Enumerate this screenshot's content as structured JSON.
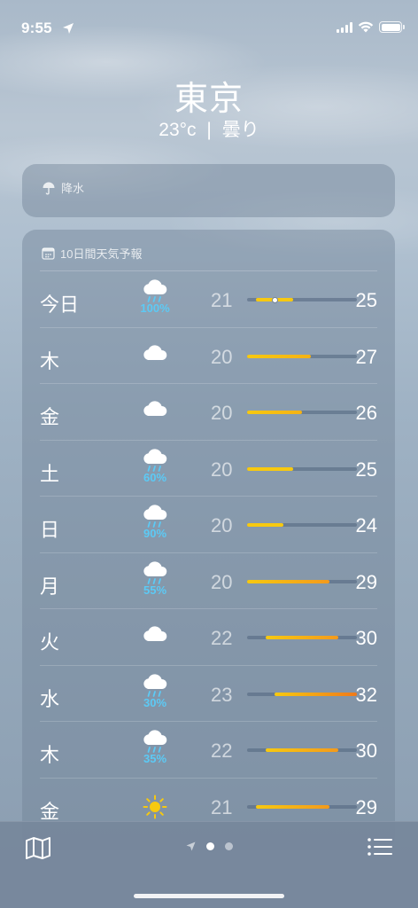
{
  "status_bar": {
    "time": "9:55"
  },
  "location": {
    "city": "東京",
    "temperature": "23°c",
    "separator": "|",
    "condition": "曇り"
  },
  "precipitation_card": {
    "title": "降水",
    "icon": "umbrella-icon"
  },
  "forecast": {
    "title": "10日間天気予報",
    "icon": "calendar-icon",
    "range_min": 20,
    "range_max": 32,
    "days": [
      {
        "day": "今日",
        "icon": "cloud-rain",
        "prob": "100%",
        "low": "21",
        "high": "25",
        "low_val": 21,
        "high_val": 25,
        "current": 23
      },
      {
        "day": "木",
        "icon": "cloud",
        "prob": "",
        "low": "20",
        "high": "27",
        "low_val": 20,
        "high_val": 27
      },
      {
        "day": "金",
        "icon": "cloud",
        "prob": "",
        "low": "20",
        "high": "26",
        "low_val": 20,
        "high_val": 26
      },
      {
        "day": "土",
        "icon": "cloud-rain",
        "prob": "60%",
        "low": "20",
        "high": "25",
        "low_val": 20,
        "high_val": 25
      },
      {
        "day": "日",
        "icon": "cloud-rain",
        "prob": "90%",
        "low": "20",
        "high": "24",
        "low_val": 20,
        "high_val": 24
      },
      {
        "day": "月",
        "icon": "cloud-rain",
        "prob": "55%",
        "low": "20",
        "high": "29",
        "low_val": 20,
        "high_val": 29
      },
      {
        "day": "火",
        "icon": "cloud",
        "prob": "",
        "low": "22",
        "high": "30",
        "low_val": 22,
        "high_val": 30
      },
      {
        "day": "水",
        "icon": "cloud-rain",
        "prob": "30%",
        "low": "23",
        "high": "32",
        "low_val": 23,
        "high_val": 32
      },
      {
        "day": "木",
        "icon": "cloud-rain",
        "prob": "35%",
        "low": "22",
        "high": "30",
        "low_val": 22,
        "high_val": 30
      },
      {
        "day": "金",
        "icon": "sun",
        "prob": "",
        "low": "21",
        "high": "29",
        "low_val": 21,
        "high_val": 29
      }
    ]
  },
  "toolbar": {
    "left_icon": "map-icon",
    "right_icon": "list-icon",
    "pages": 2,
    "active_page": 0
  },
  "colors": {
    "prob_blue": "#5ccaf5",
    "cool_yellow": "#f7c910",
    "warm_orange": "#f39a1c",
    "hot_orange": "#f07a1a"
  }
}
